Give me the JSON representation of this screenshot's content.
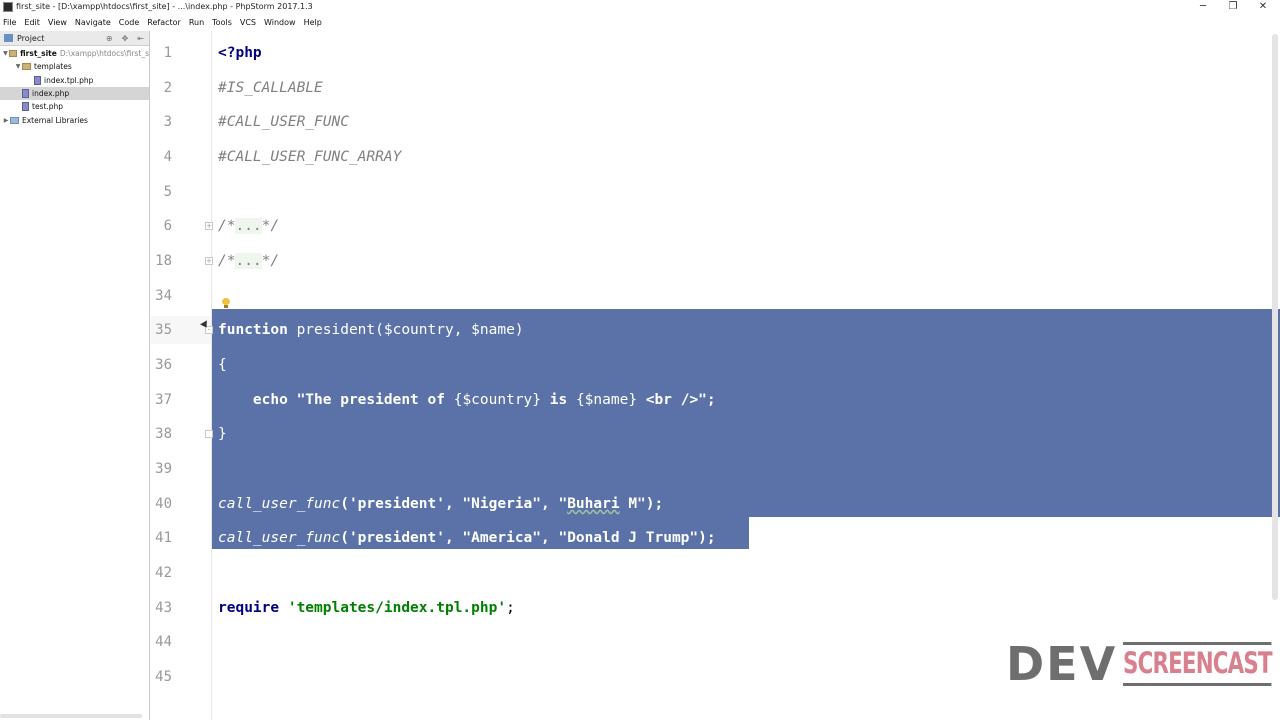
{
  "window": {
    "title": "first_site - [D:\\xampp\\htdocs\\first_site] - ...\\index.php - PhpStorm 2017.1.3",
    "controls": {
      "minimize": "─",
      "restore": "❐",
      "close": "✕"
    }
  },
  "menu": {
    "items": [
      "File",
      "Edit",
      "View",
      "Navigate",
      "Code",
      "Refactor",
      "Run",
      "Tools",
      "VCS",
      "Window",
      "Help"
    ]
  },
  "project": {
    "label": "Project",
    "toolbar_icons": [
      "⊕",
      "✥",
      "⇤"
    ],
    "tree": [
      {
        "label": "first_site",
        "path": "D:\\xampp\\htdocs\\first_s",
        "kind": "folder",
        "expanded": true,
        "level": 0
      },
      {
        "label": "templates",
        "kind": "folder",
        "expanded": true,
        "level": 1
      },
      {
        "label": "index.tpl.php",
        "kind": "php-file",
        "level": 2
      },
      {
        "label": "index.php",
        "kind": "php-file",
        "level": 1,
        "selected": true
      },
      {
        "label": "test.php",
        "kind": "php-file",
        "level": 1
      },
      {
        "label": "External Libraries",
        "kind": "library",
        "level": 0
      }
    ]
  },
  "editor": {
    "lines": [
      {
        "no": "1",
        "text": "<?php"
      },
      {
        "no": "2",
        "text": "#IS_CALLABLE"
      },
      {
        "no": "3",
        "text": "#CALL_USER_FUNC"
      },
      {
        "no": "4",
        "text": "#CALL_USER_FUNC_ARRAY"
      },
      {
        "no": "5",
        "text": ""
      },
      {
        "no": "6",
        "text": "/*...*/"
      },
      {
        "no": "18",
        "text": "/*...*/"
      },
      {
        "no": "34",
        "text": ""
      },
      {
        "no": "35",
        "text": "function president($country, $name)"
      },
      {
        "no": "36",
        "text": "{"
      },
      {
        "no": "37",
        "text": "    echo \"The president of {$country} is {$name} <br />\";"
      },
      {
        "no": "38",
        "text": "}"
      },
      {
        "no": "39",
        "text": ""
      },
      {
        "no": "40",
        "text": "call_user_func('president', \"Nigeria\", \"Buhari M\");"
      },
      {
        "no": "41",
        "text": "call_user_func('president', \"America\", \"Donald J Trump\");"
      },
      {
        "no": "42",
        "text": ""
      },
      {
        "no": "43",
        "text": "require 'templates/index.tpl.php';"
      },
      {
        "no": "44",
        "text": ""
      },
      {
        "no": "45",
        "text": ""
      }
    ],
    "tokens": {
      "php_open": "<?php",
      "c2": "#IS_CALLABLE",
      "c3": "#CALL_USER_FUNC",
      "c4": "#CALL_USER_FUNC_ARRAY",
      "fold_open": "/*",
      "fold_dots": "...",
      "fold_close": "*/",
      "l35_kw": "function",
      "l35_rest": " president($country, $name)",
      "l36": "{",
      "l37_indent": "    ",
      "l37_echo": "echo",
      "l37_str1": " \"The president of ",
      "l37_var1": "{$country}",
      "l37_str2": " is ",
      "l37_var2": "{$name}",
      "l37_str3": " <br />\";",
      "l38": "}",
      "l40_fn": "call_user_func",
      "l40_args_a": "('president', \"Nigeria\", \"",
      "l40_args_b": "Buhari",
      "l40_args_c": " M\");",
      "l41_fn": "call_user_func",
      "l41_args": "('president', \"America\", \"Donald J Trump\");",
      "l43_kw": "require",
      "l43_str": " 'templates/index.tpl.php'",
      "l43_end": ";"
    }
  },
  "watermark": {
    "left": "DEV",
    "right": "SCREENCAST"
  }
}
